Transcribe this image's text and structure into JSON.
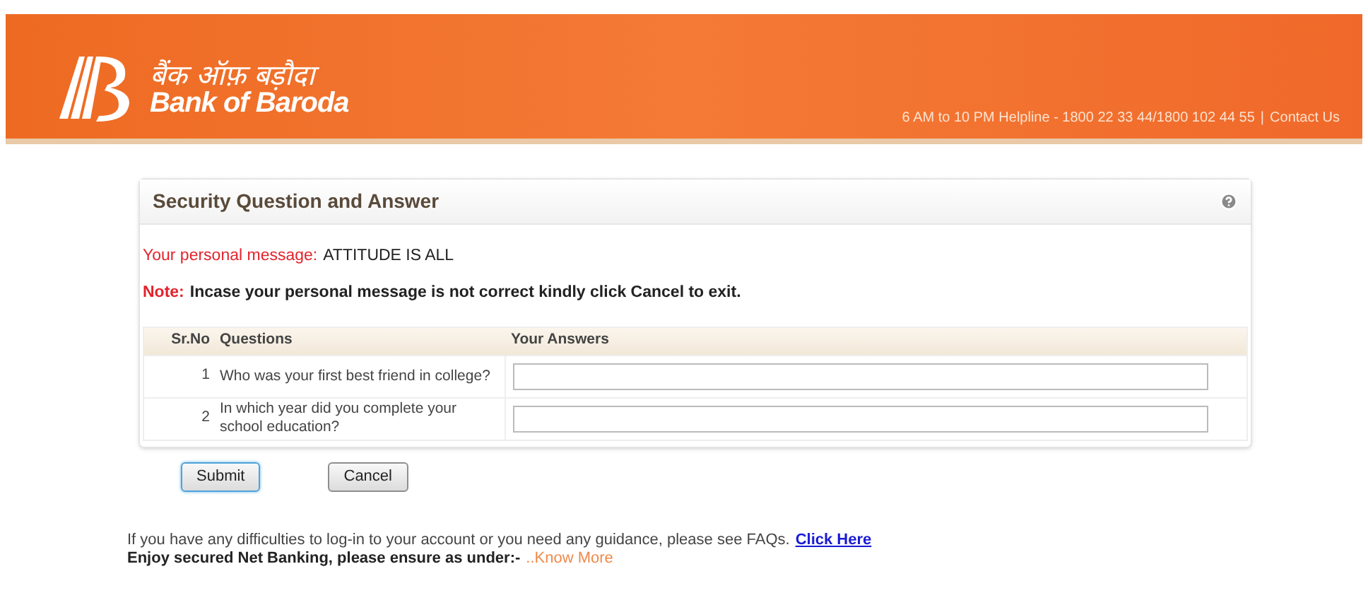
{
  "header": {
    "logo_hindi": "बैंक ऑफ़ बड़ौदा",
    "logo_english": "Bank of Baroda",
    "helpline": "6 AM to 10 PM Helpline - 1800 22 33 44/1800 102 44 55",
    "separator": "|",
    "contact_link": "Contact Us"
  },
  "panel": {
    "title": "Security Question and Answer",
    "message_label": "Your personal message:",
    "message_value": "ATTITUDE IS ALL",
    "note_label": "Note:",
    "note_text": "Incase your personal message is not correct kindly click Cancel to exit.",
    "table": {
      "columns": [
        "Sr.No",
        "Questions",
        "Your Answers"
      ],
      "rows": [
        {
          "number": "1",
          "question": "Who was your first best friend in college?"
        },
        {
          "number": "2",
          "question": "In which year did you complete your school education?"
        }
      ]
    },
    "buttons": [
      {
        "label": "Submit",
        "focused": true
      },
      {
        "label": "Cancel",
        "focused": false
      }
    ]
  },
  "footer": {
    "help_text": "If you have any difficulties to log-in to your account or you need any guidance, please see FAQs.",
    "help_link": "Click Here",
    "secure_text": "Enjoy secured Net Banking, please ensure as under:-",
    "know_more": "..Know More"
  }
}
